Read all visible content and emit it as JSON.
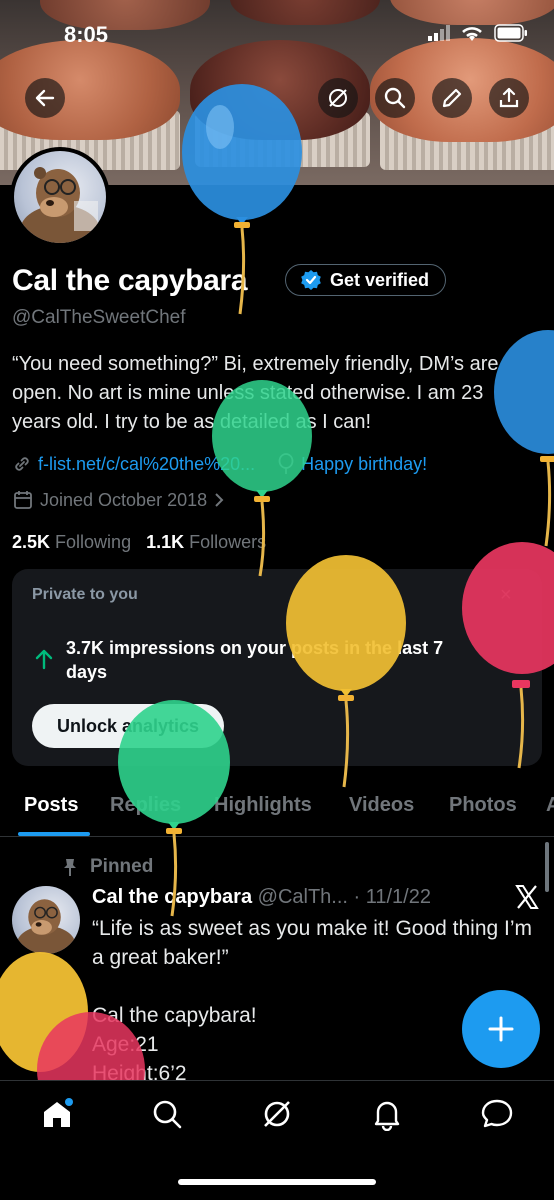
{
  "status_bar": {
    "time": "8:05"
  },
  "profile": {
    "name": "Cal the capybara",
    "verify_label": "Get verified",
    "handle": "@CalTheSweetChef",
    "bio": "“You need something?” Bi, extremely friendly, DM’s are open. No art is mine unless stated otherwise. I am 23 years old. I try to be as detailed as I can!",
    "link": "f-list.net/c/cal%20the%20...",
    "birthday": "Happy birthday!",
    "joined": "Joined October 2018",
    "following_count": "2.5K",
    "following_label": "Following",
    "followers_count": "1.1K",
    "followers_label": "Followers"
  },
  "private_card": {
    "title": "Private to you",
    "stat": "3.7K impressions on your posts in the last 7 days",
    "button": "Unlock analytics",
    "close": "×"
  },
  "tabs": [
    "Posts",
    "Replies",
    "Highlights",
    "Videos",
    "Photos",
    "A"
  ],
  "post": {
    "pinned_label": "Pinned",
    "author": "Cal the capybara",
    "handle_date": "@CalTh... · 11/1/22",
    "line1": "“Life is as sweet as you make it! Good thing I’m a great baker!”",
    "line2": "Cal the capybara!",
    "line3": "Age:21",
    "line4": "Height:6’2"
  },
  "colors": {
    "accent": "#1d9bf0",
    "background": "#000000",
    "muted": "#71767b"
  },
  "icons": [
    "back-icon",
    "no-grok-icon",
    "search-icon",
    "edit-icon",
    "share-icon",
    "verified-badge-icon",
    "link-icon",
    "balloon-icon",
    "calendar-icon",
    "arrow-up-icon",
    "pin-icon",
    "x-logo-icon",
    "plus-icon",
    "home-icon",
    "explore-icon",
    "grok-icon",
    "notifications-icon",
    "messages-icon"
  ]
}
